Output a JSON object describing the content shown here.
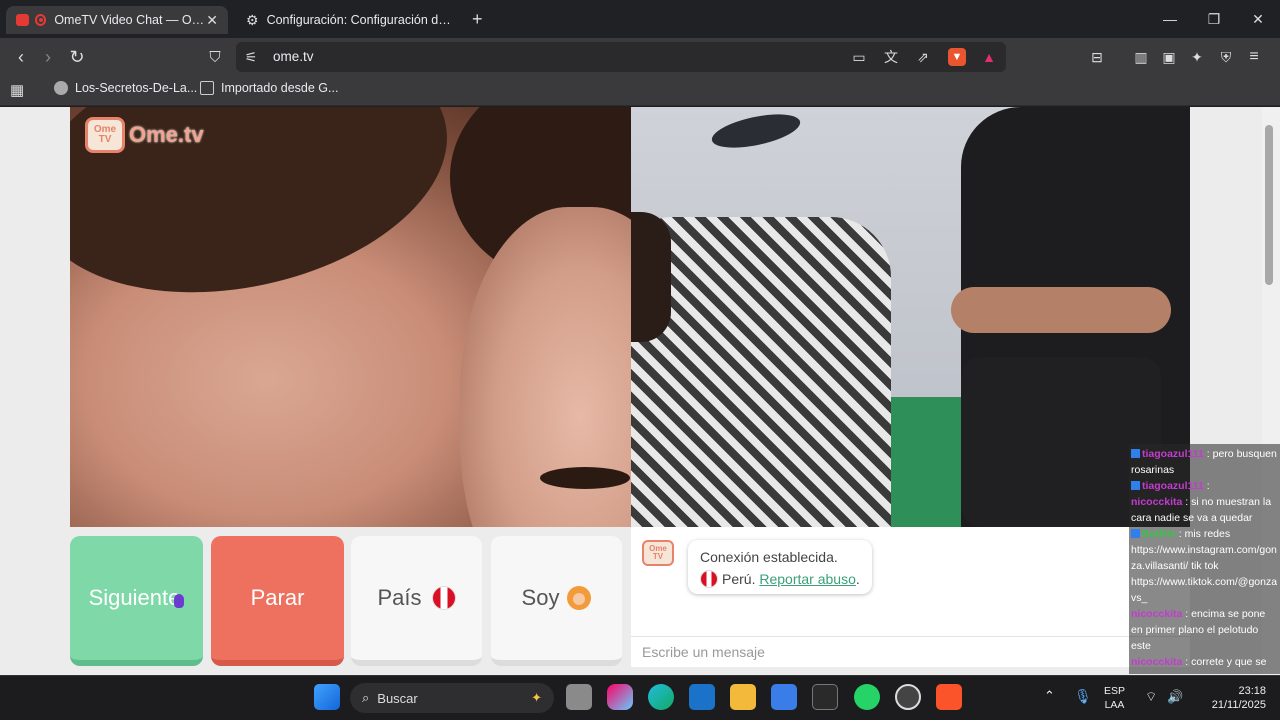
{
  "tabs": [
    {
      "title": "OmeTV Video Chat — Omegl",
      "active": true
    },
    {
      "title": "Configuración: Configuración del sitio",
      "active": false
    }
  ],
  "address": {
    "url": "ome.tv"
  },
  "bookmarks": [
    "Los-Secretos-De-La...",
    "Importado desde G..."
  ],
  "brand": {
    "logo_top": "Ome",
    "logo_bottom": "TV",
    "logo_text": "Ome.tv"
  },
  "controls": {
    "next": "Siguiente",
    "stop": "Parar",
    "country": "País",
    "soy": "Soy"
  },
  "chat": {
    "status": "Conexión establecida.",
    "country": "Perú.",
    "report": "Reportar abuso",
    "input_placeholder": "Escribe un mensaje"
  },
  "overlay_chat": [
    {
      "user": "tiagoazul111",
      "text": ": pero busquen rosarinas"
    },
    {
      "user": "tiagoazul111",
      "text": ":"
    },
    {
      "user": "nicocckita",
      "text": ": si no muestran la cara nadie se va a quedar"
    },
    {
      "user": "BotRix",
      "text": ": mis redes https://www.instagram.com/gonza.villasanti/ tik tok https://www.tiktok.com/@gonzavs_"
    },
    {
      "user": "nicocckita",
      "text": ": encima se pone en primer plano el pelotudo este"
    },
    {
      "user": "nicocckita",
      "text": ": correte y que se vea gonza"
    }
  ],
  "taskbar": {
    "search": "Buscar",
    "lang_top": "ESP",
    "lang_bottom": "LAA",
    "time": "23:18",
    "date": "21/11/2025"
  },
  "colors": {
    "next": "#7ed8a7",
    "stop": "#ee705e",
    "link": "#3aa07a",
    "brand": "#e9826a"
  }
}
